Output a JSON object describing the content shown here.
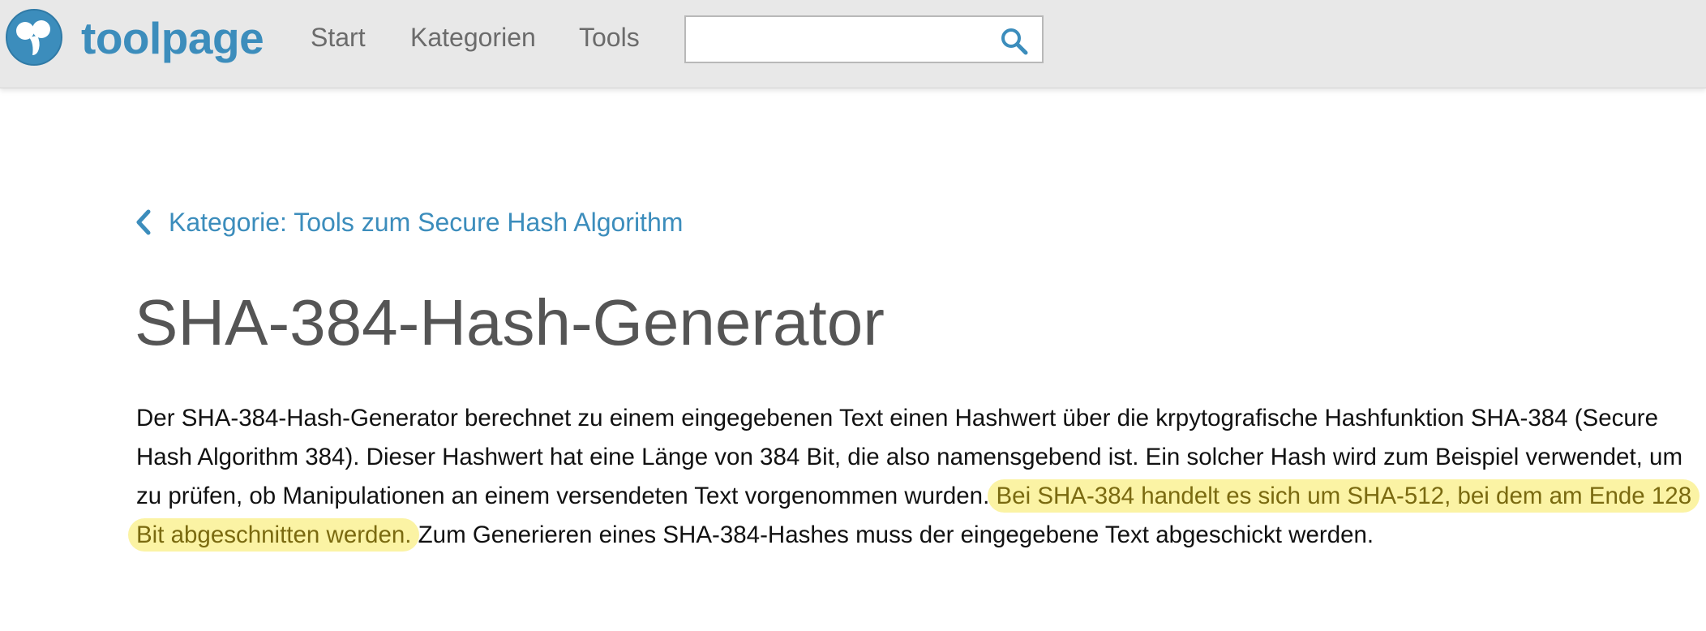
{
  "header": {
    "logo_text": "toolpage",
    "nav": [
      {
        "label": "Start"
      },
      {
        "label": "Kategorien"
      },
      {
        "label": "Tools"
      }
    ],
    "search": {
      "value": "",
      "placeholder": ""
    }
  },
  "breadcrumb": {
    "label": "Kategorie: Tools zum Secure Hash Algorithm"
  },
  "page": {
    "title": "SHA-384-Hash-Generator",
    "description_part1": "Der SHA-384-Hash-Generator berechnet zu einem eingegebenen Text einen Hashwert über die krpytografische Hashfunktion SHA-384 (Secure Hash Algorithm 384). Dieser Hashwert hat eine Länge von 384 Bit, die also namensgebend ist. Ein solcher Hash wird zum Beispiel verwendet, um zu prüfen, ob Manipulationen an einem versendeten Text vorgenommen wurden. ",
    "description_highlight": "Bei SHA-384 handelt es sich um SHA-512, bei dem am Ende 128 Bit abgeschnitten werden.",
    "description_part2": " Zum Generieren eines SHA-384-Hashes muss der eingegebene Text abgeschickt werden."
  },
  "colors": {
    "brand": "#3c8dbc",
    "header_bg": "#e8e8e8",
    "highlight": "#fbf3a4",
    "title": "#555555"
  },
  "icons": {
    "logo": "toolpage-logo-icon",
    "search": "search-icon",
    "back": "chevron-left-icon"
  }
}
